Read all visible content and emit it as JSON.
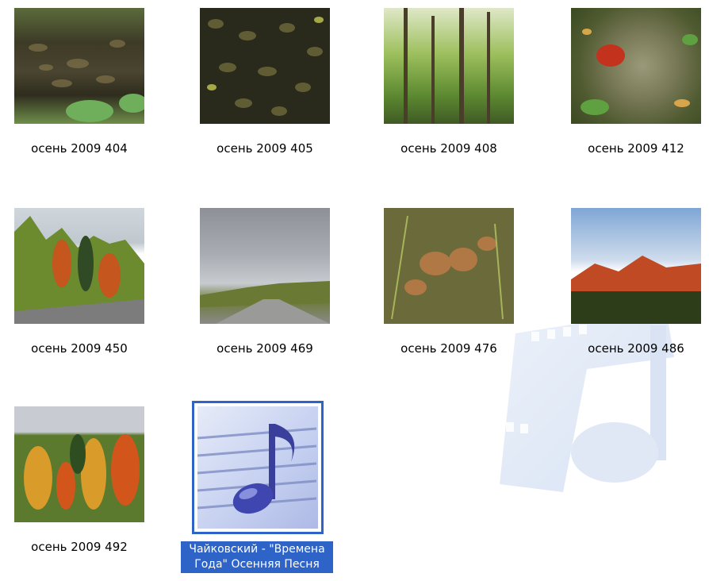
{
  "files": [
    {
      "name": "осень 2009 404",
      "thumbnail": "leaf-litter-green-photo"
    },
    {
      "name": "осень 2009 405",
      "thumbnail": "wet-leaves-photo"
    },
    {
      "name": "осень 2009 408",
      "thumbnail": "green-forest-photo"
    },
    {
      "name": "осень 2009 412",
      "thumbnail": "mossy-stump-red-mushroom-photo"
    },
    {
      "name": "осень 2009 450",
      "thumbnail": "autumn-trees-road-photo"
    },
    {
      "name": "осень 2009 469",
      "thumbnail": "cloudy-road-photo"
    },
    {
      "name": "осень 2009 476",
      "thumbnail": "brown-mushrooms-grass-photo"
    },
    {
      "name": "осень 2009 486",
      "thumbnail": "red-trees-blue-sky-photo"
    },
    {
      "name": "осень 2009 492",
      "thumbnail": "colorful-autumn-forest-photo"
    }
  ],
  "selected_file": {
    "line1": "Чайковский - \"Времена",
    "line2": "Года\" Осенняя Песня",
    "icon": "music-note-icon"
  },
  "colors": {
    "selection": "#2e63c7"
  }
}
